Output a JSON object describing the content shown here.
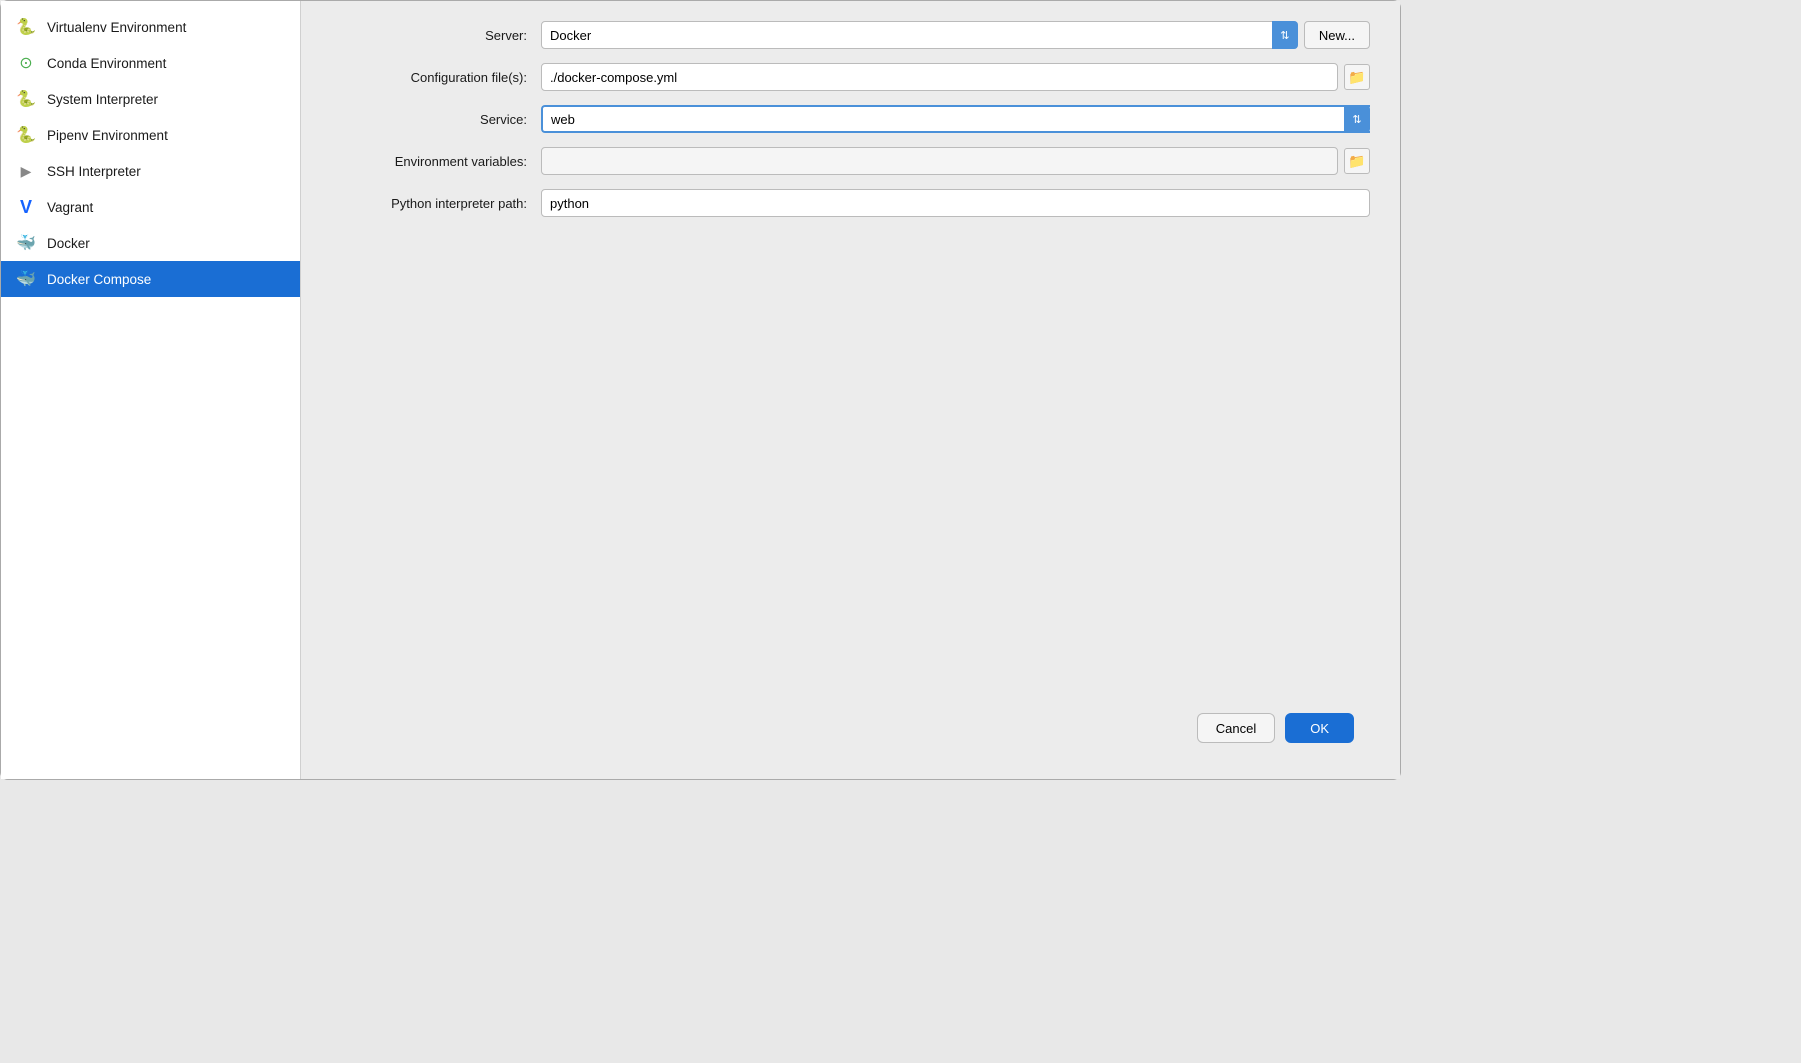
{
  "sidebar": {
    "items": [
      {
        "id": "virtualenv",
        "label": "Virtualenv Environment",
        "icon": "🐍",
        "active": false
      },
      {
        "id": "conda",
        "label": "Conda Environment",
        "icon": "○",
        "active": false
      },
      {
        "id": "system",
        "label": "System Interpreter",
        "icon": "🐍",
        "active": false
      },
      {
        "id": "pipenv",
        "label": "Pipenv Environment",
        "icon": "🐍",
        "active": false
      },
      {
        "id": "ssh",
        "label": "SSH Interpreter",
        "icon": "▶",
        "active": false
      },
      {
        "id": "vagrant",
        "label": "Vagrant",
        "icon": "V",
        "active": false
      },
      {
        "id": "docker",
        "label": "Docker",
        "icon": "🐳",
        "active": false
      },
      {
        "id": "docker-compose",
        "label": "Docker Compose",
        "icon": "🐳",
        "active": true
      }
    ]
  },
  "form": {
    "server_label": "Server:",
    "server_value": "Docker",
    "server_new_btn": "New...",
    "config_label": "Configuration file(s):",
    "config_value": "./docker-compose.yml",
    "service_label": "Service:",
    "service_value": "web",
    "env_label": "Environment variables:",
    "env_value": "",
    "python_label": "Python interpreter path:",
    "python_value": "python"
  },
  "footer": {
    "cancel_label": "Cancel",
    "ok_label": "OK"
  },
  "icons": {
    "virtualenv": "🐍",
    "conda_circle": "○",
    "system": "🐍",
    "pipenv": "🐍",
    "ssh_arrow": "▶",
    "vagrant_v": "V",
    "docker_whale": "🐳",
    "docker_compose_whale": "🐳",
    "folder_browse": "📁",
    "chevron_down": "⌄",
    "chevron_updown": "⇅"
  }
}
